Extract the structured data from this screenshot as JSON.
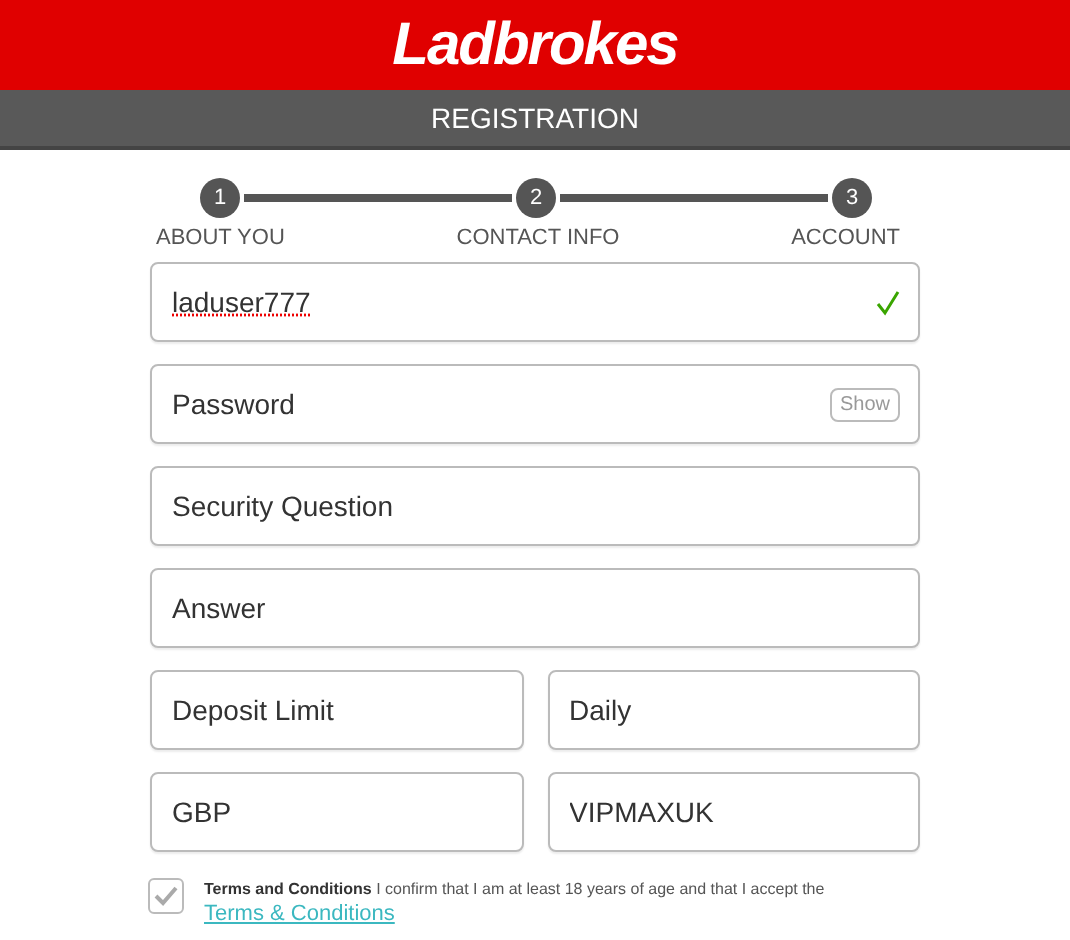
{
  "header": {
    "logo": "Ladbrokes"
  },
  "title_bar": {
    "title": "REGISTRATION"
  },
  "steps": [
    {
      "number": "1",
      "label": "ABOUT YOU"
    },
    {
      "number": "2",
      "label": "CONTACT INFO"
    },
    {
      "number": "3",
      "label": "ACCOUNT"
    }
  ],
  "fields": [
    {
      "kind": "text",
      "value": "laduser777",
      "valid": true
    },
    {
      "kind": "password",
      "placeholder": "Password",
      "action": "Show"
    },
    {
      "kind": "text",
      "placeholder": "Security Question"
    },
    {
      "kind": "text",
      "placeholder": "Answer"
    },
    {
      "kind": "half",
      "placeholder": "Deposit Limit"
    },
    {
      "kind": "half",
      "placeholder": "Daily"
    },
    {
      "kind": "half",
      "placeholder": "GBP"
    },
    {
      "kind": "half",
      "value": "VIPMAXUK"
    }
  ],
  "terms": {
    "checked": true,
    "text": "**Terms and Conditions** I confirm that I am at least 18 years of age and that I accept the",
    "link": "Terms & Conditions"
  }
}
